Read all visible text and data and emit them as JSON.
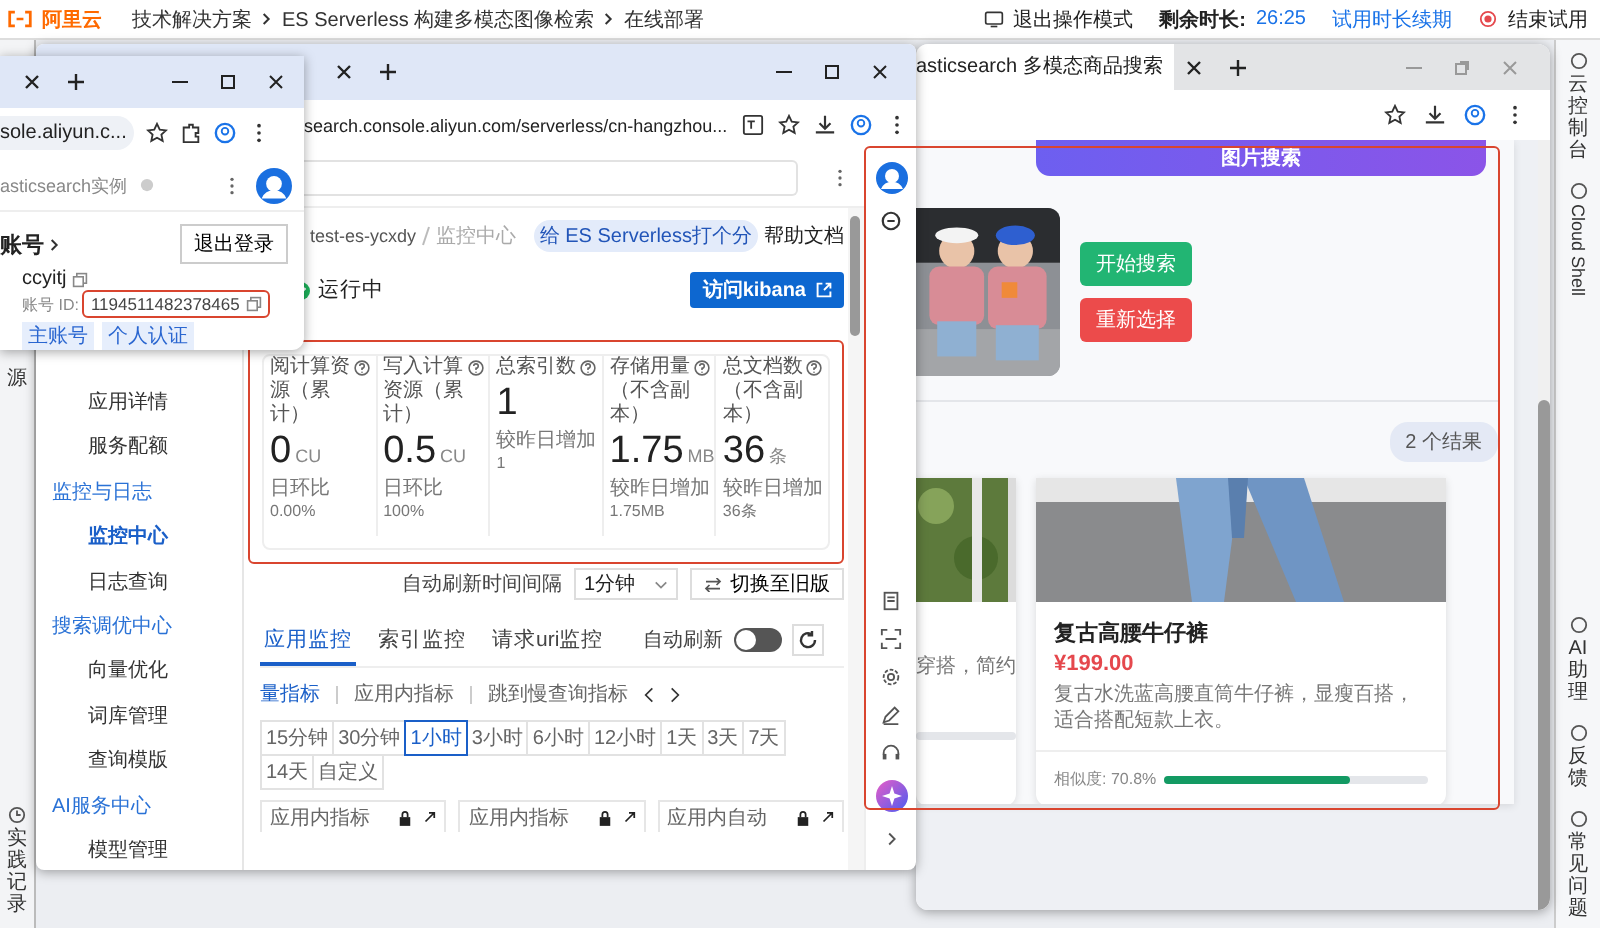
{
  "top_bar": {
    "logo": "阿里云",
    "breadcrumbs": [
      "技术解决方案",
      "ES Serverless 构建多模态图像检索",
      "在线部署"
    ],
    "exit_mode": "退出操作模式",
    "remaining_label": "剩余时长:",
    "remaining_time": "26:25",
    "extend": "试用时长续期",
    "end": "结束试用"
  },
  "left_rail": {
    "cut_label": "源",
    "record": "实践记录"
  },
  "right_rail": [
    {
      "label": "云控制台",
      "kind": "cjk"
    },
    {
      "label": "Cloud Shell",
      "kind": "latin"
    },
    {
      "label": "AI助理",
      "kind": "cjk"
    },
    {
      "label": "反馈",
      "kind": "cjk"
    },
    {
      "label": "常见问题",
      "kind": "cjk"
    }
  ],
  "account_window": {
    "url": "sole.aliyun.c...",
    "search_placeholder": "asticsearch实例",
    "title": "账号",
    "logout": "退出登录",
    "username": "ccyitj",
    "id_label": "账号 ID:",
    "id": "1194511482378465",
    "tags": [
      "主账号",
      "个人认证"
    ]
  },
  "console_window": {
    "url": "search.console.aliyun.com/serverless/cn-hangzhou...",
    "breadcrumbs": [
      "test-es-ycxdy",
      "监控中心"
    ],
    "rating": "给 ES Serverless打个分",
    "help": "帮助文档",
    "status": "运行中",
    "kibana": "访问kibana",
    "sidebar": [
      {
        "label": "应用详情",
        "kind": "item",
        "selected": false
      },
      {
        "label": "服务配额",
        "kind": "item",
        "selected": false
      },
      {
        "label": "监控与日志",
        "kind": "group",
        "selected": false
      },
      {
        "label": "监控中心",
        "kind": "item",
        "selected": true
      },
      {
        "label": "日志查询",
        "kind": "item",
        "selected": false
      },
      {
        "label": "搜索调优中心",
        "kind": "group",
        "selected": false
      },
      {
        "label": "向量优化",
        "kind": "item",
        "selected": false
      },
      {
        "label": "词库管理",
        "kind": "item",
        "selected": false
      },
      {
        "label": "查询模版",
        "kind": "item",
        "selected": false
      },
      {
        "label": "AI服务中心",
        "kind": "group",
        "selected": false
      },
      {
        "label": "模型管理",
        "kind": "item",
        "selected": false
      }
    ],
    "stats": [
      {
        "label": "阅计算资源（累计）",
        "value": "0",
        "unit": "CU",
        "compare_label": "日环比",
        "compare_value": "0.00%"
      },
      {
        "label": "写入计算资源（累计）",
        "value": "0.5",
        "unit": "CU",
        "compare_label": "日环比",
        "compare_value": "100%"
      },
      {
        "label": "总索引数",
        "value": "1",
        "compare_label": "较昨日增加",
        "compare_value": "1"
      },
      {
        "label": "存储用量（不含副本）",
        "value": "1.75",
        "unit": "MB",
        "compare_label": "较昨日增加",
        "compare_value": "1.75MB"
      },
      {
        "label": "总文档数（不含副本）",
        "value": "36",
        "unit": "条",
        "compare_label": "较昨日增加",
        "compare_value": "36条"
      }
    ],
    "refresh_label": "自动刷新时间间隔",
    "refresh_value": "1分钟",
    "switch_old": "切换至旧版",
    "tabs": [
      {
        "label": "应用监控",
        "selected": true
      },
      {
        "label": "索引监控",
        "selected": false
      },
      {
        "label": "请求uri监控",
        "selected": false
      }
    ],
    "auto_refresh": {
      "label": "自动刷新",
      "on": false
    },
    "subtabs": [
      {
        "label": "量指标",
        "selected": true
      },
      {
        "label": "应用内指标",
        "selected": false
      },
      {
        "label": "跳到慢查询指标",
        "selected": false
      }
    ],
    "ranges": [
      {
        "label": "15分钟",
        "selected": false
      },
      {
        "label": "30分钟",
        "selected": false
      },
      {
        "label": "1小时",
        "selected": true
      },
      {
        "label": "3小时",
        "selected": false
      },
      {
        "label": "6小时",
        "selected": false
      },
      {
        "label": "12小时",
        "selected": false
      },
      {
        "label": "1天",
        "selected": false
      },
      {
        "label": "3天",
        "selected": false
      },
      {
        "label": "7天",
        "selected": false
      },
      {
        "label": "14天",
        "selected": false
      },
      {
        "label": "自定义",
        "selected": false
      }
    ],
    "panels": [
      "应用内指标",
      "应用内指标",
      "应用内自动"
    ]
  },
  "search_window": {
    "tab": "asticsearch 多模态商品搜索",
    "search_button": "图片搜索",
    "start": "开始搜索",
    "reselect": "重新选择",
    "result_count": "2 个结果",
    "products": [
      {
        "kind": "partial",
        "description": "穿搭，简约"
      },
      {
        "kind": "full",
        "name": "复古高腰牛仔裤",
        "price": "¥199.00",
        "description": "复古水洗蓝高腰直筒牛仔裤，显瘦百搭，适合搭配短款上衣。",
        "similarity": "相似度: 70.8%",
        "level": 0.708
      }
    ]
  }
}
